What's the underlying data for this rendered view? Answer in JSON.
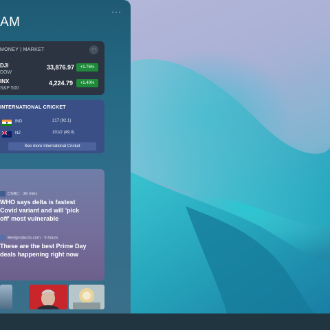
{
  "panel": {
    "time": "AM",
    "more_icon": "more-horizontal-icon"
  },
  "money": {
    "header": "MONEY | MARKET",
    "more_icon": "more-icon",
    "stocks": [
      {
        "symbol": "DJI",
        "name": "DOW",
        "value": "33,876.97",
        "change": "+1.76%"
      },
      {
        "symbol": "INX",
        "name": "S&P 500",
        "value": "4,224.79",
        "change": "+1.40%"
      }
    ],
    "accent_positive": "#1f8a3a"
  },
  "cricket": {
    "header": "INTERNATIONAL CRICKET",
    "teams": [
      {
        "team": "IND",
        "score": "217 (92.1)",
        "flag_icon": "india-flag-icon"
      },
      {
        "team": "NZ",
        "score": "101/2 (49.0)",
        "flag_icon": "new-zealand-flag-icon"
      }
    ],
    "see_more": "See more International Cricket"
  },
  "news": [
    {
      "source": "CNBC · 38 mins",
      "title": "WHO says delta is fastest Covid variant and will 'pick off' most vulnerable"
    },
    {
      "source": "Bestproducts.com · 5 hours",
      "title": "These are the best Prime Day deals happening right now"
    }
  ]
}
